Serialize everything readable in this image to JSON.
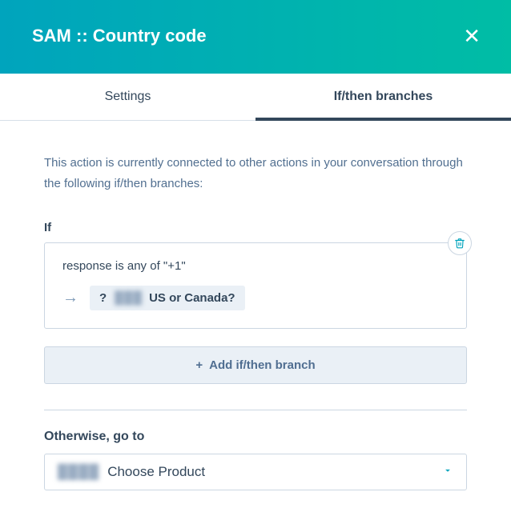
{
  "header": {
    "title": "SAM :: Country code"
  },
  "tabs": {
    "settings": "Settings",
    "branches": "If/then branches"
  },
  "description": "This action is currently connected to other actions in your conversation through the following if/then branches:",
  "branch": {
    "label": "If",
    "condition": "response is any of \"+1\"",
    "target_prefix": "?",
    "target_blur": "███",
    "target_text": "US or Canada?"
  },
  "add_branch_label": "Add if/then branch",
  "otherwise": {
    "label": "Otherwise, go to",
    "select_blur": "████",
    "select_value": "Choose Product"
  }
}
